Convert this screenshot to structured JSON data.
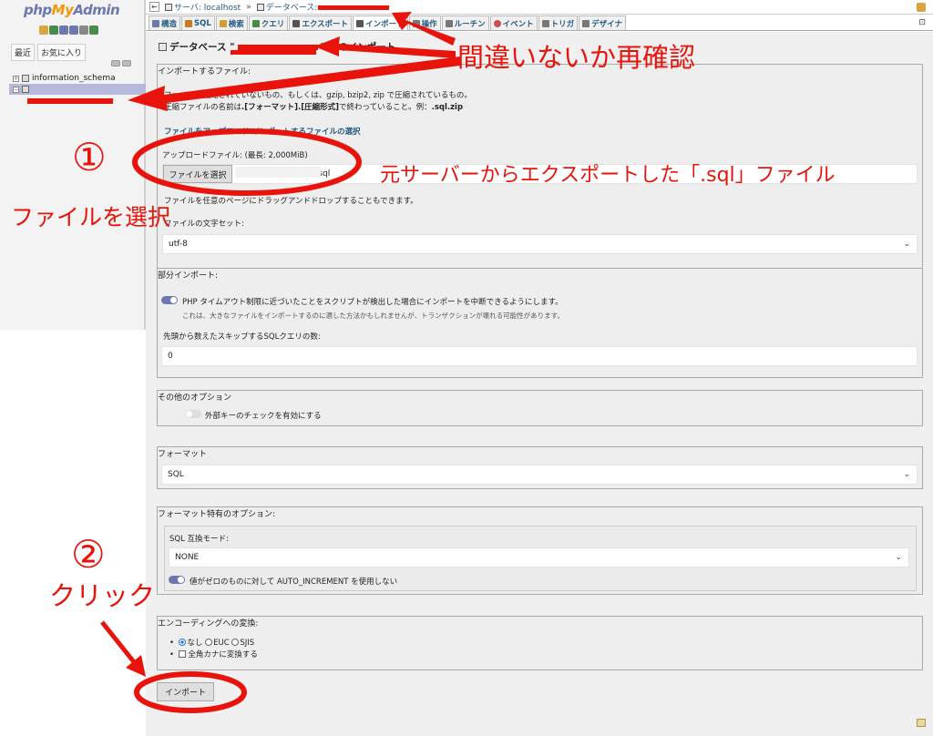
{
  "sidebar": {
    "logo": {
      "php": "php",
      "my": "My",
      "admin": "Admin"
    },
    "tabs": [
      "最近",
      "お気に入り"
    ],
    "tree": [
      {
        "label": "information_schema",
        "selected": false
      },
      {
        "label": "",
        "selected": true
      }
    ]
  },
  "topbar": {
    "server_label": "サーバ: localhost",
    "separator": "»",
    "db_label": "データベース:"
  },
  "menu": {
    "tabs": [
      {
        "label": "構造",
        "icon": "structure-icon",
        "color": "#6c78af"
      },
      {
        "label": "SQL",
        "icon": "sql-icon",
        "color": "#c87a1e"
      },
      {
        "label": "検索",
        "icon": "search-icon",
        "color": "#d0a030"
      },
      {
        "label": "クエリ",
        "icon": "query-icon",
        "color": "#4a8a4a"
      },
      {
        "label": "エクスポート",
        "icon": "export-icon",
        "color": "#555555"
      },
      {
        "label": "インポート",
        "icon": "import-icon",
        "color": "#555555"
      },
      {
        "label": "操作",
        "icon": "wrench-icon",
        "color": "#777777"
      },
      {
        "label": "ルーチン",
        "icon": "routine-icon",
        "color": "#777777"
      },
      {
        "label": "イベント",
        "icon": "clock-icon",
        "color": "#c85050"
      },
      {
        "label": "トリガ",
        "icon": "trigger-icon",
        "color": "#777777"
      },
      {
        "label": "デザイナ",
        "icon": "designer-icon",
        "color": "#777777"
      }
    ]
  },
  "page": {
    "title_prefix": "データベース \"",
    "title_suffix": "\" へのインポート"
  },
  "file_section": {
    "legend": "インポートするファイル:",
    "desc1": "ファイルは圧縮されていないもの、もしくは、gzip, bzip2, zip で圧縮されているもの。",
    "desc2_prefix": "圧縮ファイルの名前は",
    "desc2_bold": ".[フォーマット].[圧縮形式]",
    "desc2_mid": "で終わっていること。例：",
    "desc2_example": ".sql.zip",
    "upload_link": "ファイルをアップロード",
    "select_link": "インポートするファイルの選択",
    "upload_label": "アップロードファイル:",
    "upload_limit": "(最長: 2,000MiB)",
    "choose_button": "ファイルを選択",
    "chosen_file": "zu.sql",
    "drag_note": "ファイルを任意のページにドラッグアンドドロップすることもできます。",
    "charset_label": "ファイルの文字セット:",
    "charset_value": "utf-8"
  },
  "partial_section": {
    "legend": "部分インポート:",
    "timeout_label": "PHP タイムアウト制限に近づいたことをスクリプトが検出した場合にインポートを中断できるようにします。",
    "timeout_note": "これは、大きなファイルをインポートするのに適した方法かもしれませんが、トランザクションが壊れる可能性があります。",
    "skip_label": "先頭から数えたスキップするSQLクエリの数:",
    "skip_value": "0"
  },
  "other_section": {
    "legend": "その他のオプション",
    "fk_label": "外部キーのチェックを有効にする"
  },
  "format_section": {
    "legend": "フォーマット",
    "value": "SQL"
  },
  "format_options": {
    "legend": "フォーマット特有のオプション:",
    "compat_label": "SQL 互換モード:",
    "compat_value": "NONE",
    "autoinc_label": "値がゼロのものに対して AUTO_INCREMENT を使用しない"
  },
  "encoding_section": {
    "legend": "エンコーディングへの変換:",
    "opt_none": "なし",
    "opt_euc": "EUC",
    "opt_sjis": "SJIS",
    "kana_label": "全角カナに変換する"
  },
  "import_button": "インポート",
  "annotations": {
    "confirm": "間違いないか再確認",
    "step1_num": "①",
    "step1_text": "ファイルを選択",
    "file_note": "元サーバーからエクスポートした「.sql」ファイル",
    "step2_num": "②",
    "step2_text": "クリック",
    "color": "#e8140c"
  }
}
